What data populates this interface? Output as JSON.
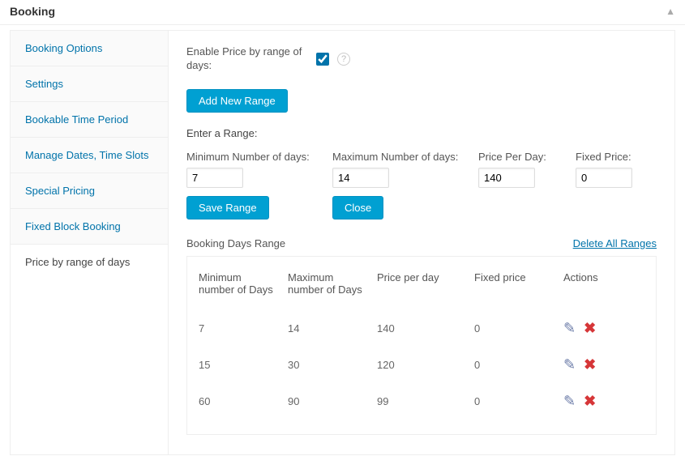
{
  "panel": {
    "title": "Booking"
  },
  "tabs": [
    {
      "label": "Booking Options"
    },
    {
      "label": "Settings"
    },
    {
      "label": "Bookable Time Period"
    },
    {
      "label": "Manage Dates, Time Slots"
    },
    {
      "label": "Special Pricing"
    },
    {
      "label": "Fixed Block Booking"
    },
    {
      "label": "Price by range of days",
      "active": true
    }
  ],
  "enable": {
    "label": "Enable Price by range of days:",
    "checked": true
  },
  "buttons": {
    "add_range": "Add New Range",
    "save_range": "Save Range",
    "close": "Close"
  },
  "form": {
    "section_label": "Enter a Range:",
    "min_label": "Minimum Number of days:",
    "max_label": "Maximum Number of days:",
    "price_label": "Price Per Day:",
    "fixed_label": "Fixed Price:",
    "min_value": "7",
    "max_value": "14",
    "price_value": "140",
    "fixed_value": "0"
  },
  "range_section": {
    "title": "Booking Days Range",
    "delete_all": "Delete All Ranges",
    "headers": {
      "min": "Minimum number of Days",
      "max": "Maximum number of Days",
      "price": "Price per day",
      "fixed": "Fixed price",
      "actions": "Actions"
    },
    "rows": [
      {
        "min": "7",
        "max": "14",
        "price": "140",
        "fixed": "0"
      },
      {
        "min": "15",
        "max": "30",
        "price": "120",
        "fixed": "0"
      },
      {
        "min": "60",
        "max": "90",
        "price": "99",
        "fixed": "0"
      }
    ]
  },
  "icons": {
    "help": "?",
    "edit": "✎",
    "delete": "✖",
    "collapse": "▲"
  }
}
